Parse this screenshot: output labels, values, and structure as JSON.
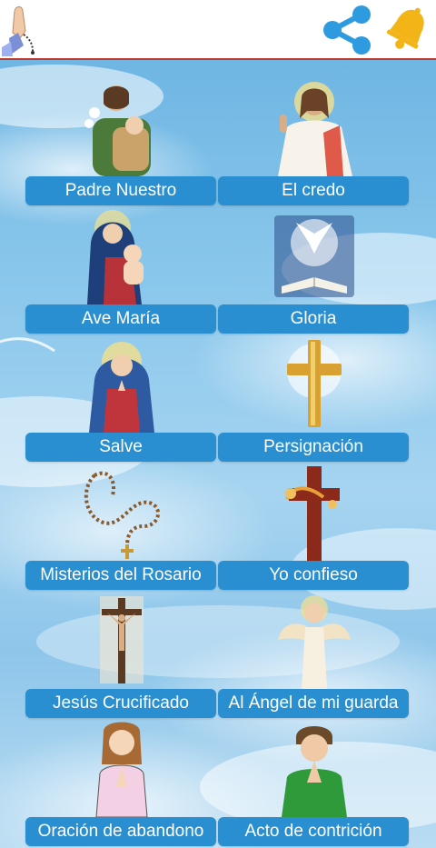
{
  "header": {
    "logo_icon": "praying-hands-rosary-icon",
    "share_icon": "share-icon",
    "bell_icon": "bell-icon",
    "accent_color": "#c0392b",
    "share_color": "#2e9be0",
    "bell_color": "#f2b417"
  },
  "prayers": [
    {
      "label": "Padre Nuestro",
      "icon": "saint-joseph-with-child-icon"
    },
    {
      "label": "El credo",
      "icon": "jesus-blessing-icon"
    },
    {
      "label": "Ave María",
      "icon": "virgin-mary-with-child-icon"
    },
    {
      "label": "Gloria",
      "icon": "dove-over-bible-icon"
    },
    {
      "label": "Salve",
      "icon": "praying-virgin-icon"
    },
    {
      "label": "Persignación",
      "icon": "golden-cross-icon"
    },
    {
      "label": "Misterios del Rosario",
      "icon": "rosary-icon"
    },
    {
      "label": "Yo confieso",
      "icon": "wooden-cross-icon"
    },
    {
      "label": "Jesús Crucificado",
      "icon": "crucifix-icon"
    },
    {
      "label": "Al Ángel de mi guarda",
      "icon": "guardian-angel-icon"
    },
    {
      "label": "Oración de abandono",
      "icon": "praying-girl-icon"
    },
    {
      "label": "Acto de contrición",
      "icon": "praying-man-icon"
    }
  ],
  "button_color": "#2a8fd0"
}
